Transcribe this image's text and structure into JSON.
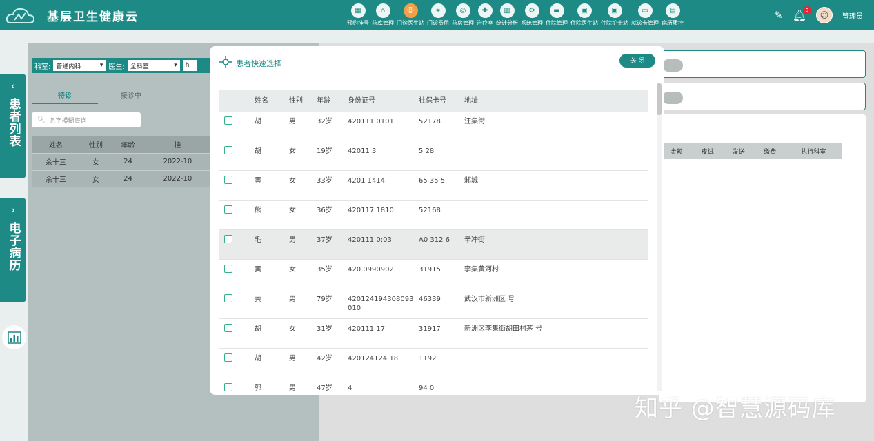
{
  "app": {
    "title": "基层卫生健康云"
  },
  "nav": [
    {
      "label": "预约挂号",
      "icon": "calendar-icon",
      "glyph": "▦"
    },
    {
      "label": "药库管理",
      "icon": "house-icon",
      "glyph": "⌂"
    },
    {
      "label": "门诊医生站",
      "icon": "doctor-icon",
      "glyph": "☺",
      "active": true
    },
    {
      "label": "门诊费用",
      "icon": "yen-icon",
      "glyph": "¥"
    },
    {
      "label": "药房管理",
      "icon": "pill-icon",
      "glyph": "◎"
    },
    {
      "label": "治疗室",
      "icon": "treatment-icon",
      "glyph": "✚"
    },
    {
      "label": "统计分析",
      "icon": "bar-chart-icon",
      "glyph": "▥"
    },
    {
      "label": "系统管理",
      "icon": "gear-icon",
      "glyph": "⚙"
    },
    {
      "label": "住院管理",
      "icon": "bed-icon",
      "glyph": "▬"
    },
    {
      "label": "住院医生站",
      "icon": "doctor-card-icon",
      "glyph": "▣"
    },
    {
      "label": "住院护士站",
      "icon": "nurse-icon",
      "glyph": "▣"
    },
    {
      "label": "就诊卡管理",
      "icon": "card-icon",
      "glyph": "▭"
    },
    {
      "label": "病历质控",
      "icon": "record-icon",
      "glyph": "▤"
    }
  ],
  "user": {
    "name": "管理员",
    "notifications": "0"
  },
  "side_tabs": {
    "patients": "患者列表",
    "emr": "电子病历"
  },
  "filter": {
    "dept_label": "科室:",
    "dept_value": "普通内科",
    "doctor_label": "医生:",
    "doctor_value": "全科室",
    "extra": "h"
  },
  "tabs": [
    "待诊",
    "接诊中"
  ],
  "search": {
    "placeholder": "名字模糊查询"
  },
  "left_table": {
    "headers": [
      "姓名",
      "性别",
      "年龄",
      "挂"
    ],
    "rows": [
      [
        "余十三",
        "女",
        "24",
        "2022-10"
      ],
      [
        "余十三",
        "女",
        "24",
        "2022-10"
      ]
    ]
  },
  "right_table_headers": [
    "金额",
    "皮试",
    "发送",
    "缴费",
    "执行科室"
  ],
  "modal": {
    "title": "患者快速选择",
    "close_label": "关 闭",
    "headers": [
      "姓名",
      "性别",
      "年龄",
      "身份证号",
      "社保卡号",
      "地址"
    ],
    "rows": [
      {
        "name": "胡",
        "gender": "男",
        "age": "32岁",
        "id": "420111 0101",
        "ss": "52178",
        "addr": "汪集街"
      },
      {
        "name": "胡",
        "gender": "女",
        "age": "19岁",
        "id": "42011 3",
        "ss": "5 28",
        "addr": ""
      },
      {
        "name": "黄",
        "gender": "女",
        "age": "33岁",
        "id": "4201 1414",
        "ss": "65 35 5",
        "addr": "邾城"
      },
      {
        "name": "熊",
        "gender": "女",
        "age": "36岁",
        "id": "420117 1810",
        "ss": "52168",
        "addr": ""
      },
      {
        "name": "毛",
        "gender": "男",
        "age": "37岁",
        "id": "420111 0:03",
        "ss": "A0 312 6",
        "addr": "辛冲街"
      },
      {
        "name": "黄",
        "gender": "女",
        "age": "35岁",
        "id": "420 0990902",
        "ss": "31915",
        "addr": "李集黄河村"
      },
      {
        "name": "黄",
        "gender": "男",
        "age": "79岁",
        "id": "420124194308093010",
        "ss": "46339",
        "addr": "武汉市新洲区 号"
      },
      {
        "name": "胡",
        "gender": "女",
        "age": "31岁",
        "id": "420111 17",
        "ss": "31917",
        "addr": "新洲区李集街胡田村茅 号"
      },
      {
        "name": "胡",
        "gender": "男",
        "age": "42岁",
        "id": "420124124 18",
        "ss": "1192",
        "addr": ""
      },
      {
        "name": "郭",
        "gender": "男",
        "age": "47岁",
        "id": "4",
        "ss": "94 0",
        "addr": ""
      }
    ]
  },
  "watermark": "知乎 @智慧源码库"
}
